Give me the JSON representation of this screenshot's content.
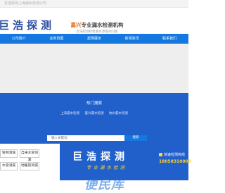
{
  "topbar": {
    "text": "巨浩探测上海漏水检测公司"
  },
  "header": {
    "logo": "巨浩探测",
    "city": "嘉兴",
    "slogan": "专业漏水检测机构",
    "subslogan": "巨浩检测检修漏水渗漏水问题"
  },
  "nav": [
    "公司简介",
    "业务范围",
    "案例展示",
    "新闻资讯",
    "联系我们"
  ],
  "hot": {
    "title": "热门搜索",
    "links": [
      "上海漏水检测",
      "嘉兴漏水检测",
      "杭州漏水检测"
    ],
    "search_placeholder": "输入关键词",
    "search_button": "搜索"
  },
  "tiles": [
    "管网测漏",
    "自来水管测漏",
    "水管测漏",
    "地暖管测漏"
  ],
  "promo": {
    "logo": "巨浩探测",
    "sub": "专业漏水检测",
    "hotline_label": "快速检测热线",
    "hotline_number": "18058310000"
  },
  "watermark": "便民库",
  "colors": {
    "nav_blue": "#1478e0",
    "panel_blue": "#2160ca",
    "accent_orange": "#e46b12",
    "accent_yellow": "#ffd23a"
  }
}
